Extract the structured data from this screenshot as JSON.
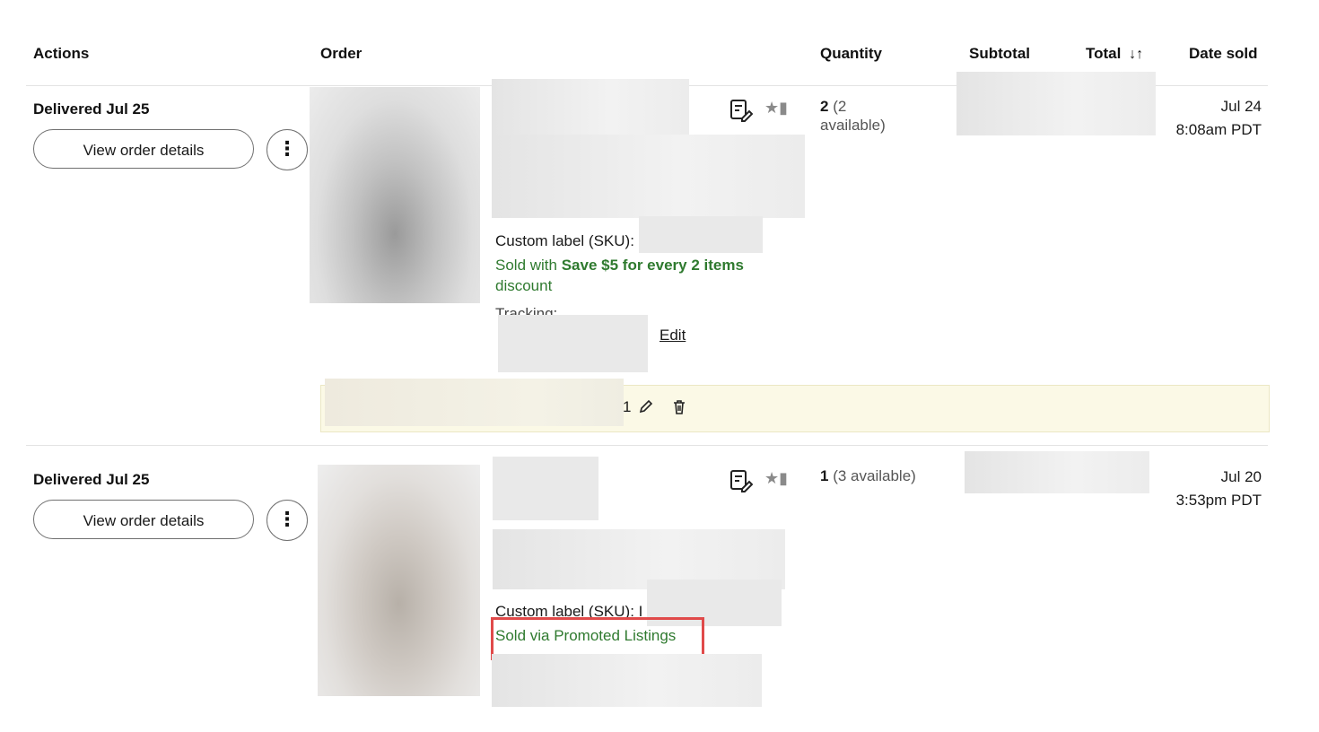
{
  "header": {
    "actions": "Actions",
    "order": "Order",
    "quantity": "Quantity",
    "subtotal": "Subtotal",
    "total": "Total",
    "total_sort_icon": "sort-arrows-icon",
    "date_sold": "Date sold"
  },
  "orders": [
    {
      "status": "Delivered Jul 25",
      "view_details_label": "View order details",
      "more_icon": "⋮",
      "custom_label": "Custom label (SKU):",
      "discount_prefix": "Sold with",
      "discount_bold": "Save $5 for every 2 items",
      "discount_suffix": "discount",
      "tracking_label": "Tracking:",
      "edit_label": "Edit",
      "quantity_num": "2",
      "quantity_avail_1": "(2",
      "quantity_avail_2": "available)",
      "date": "Jul 24",
      "time": "8:08am PDT",
      "note_digit": "1"
    },
    {
      "status": "Delivered Jul 25",
      "view_details_label": "View order details",
      "more_icon": "⋮",
      "custom_label": "Custom label (SKU): I",
      "promoted_label": "Sold via Promoted Listings",
      "quantity_num": "1",
      "quantity_avail": "(3 available)",
      "date": "Jul 20",
      "time": "3:53pm PDT"
    }
  ],
  "colors": {
    "accent_green": "#2f7a2f",
    "note_background": "#fbf9e6",
    "highlight_red": "#e04a4a"
  }
}
